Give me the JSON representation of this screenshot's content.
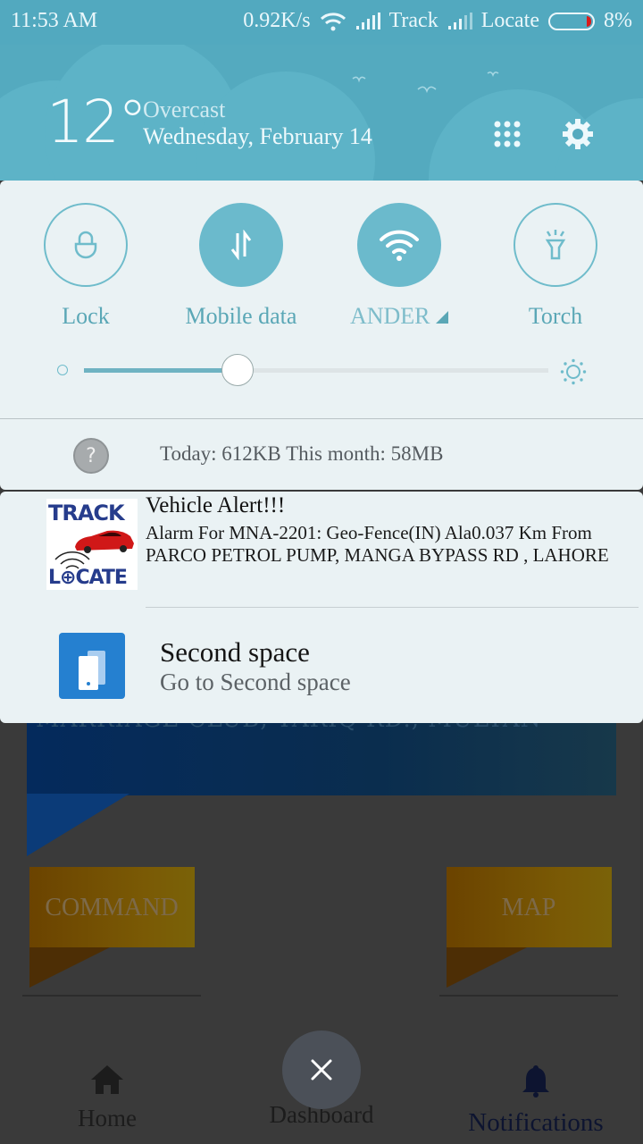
{
  "status_bar": {
    "time": "11:53 AM",
    "net_speed": "0.92K/s",
    "sim1_label": "Track",
    "sim2_label": "Locate",
    "battery": "8%",
    "battery_level_pct": 8
  },
  "weather": {
    "temperature": "12°",
    "condition": "Overcast",
    "date": "Wednesday, February 14"
  },
  "header_icons": [
    "apps-grid-icon",
    "settings-gear-icon"
  ],
  "quick_settings": {
    "tiles": [
      {
        "label": "Lock",
        "icon": "lock-icon",
        "active": false
      },
      {
        "label": "Mobile data",
        "icon": "data-arrows-icon",
        "active": true
      },
      {
        "label": "ANDER",
        "icon": "wifi-icon",
        "active": true
      },
      {
        "label": "Torch",
        "icon": "flashlight-icon",
        "active": false
      }
    ],
    "brightness_pct": 33,
    "data_usage": "Today: 612KB This month: 58MB",
    "help_glyph": "?"
  },
  "notifications": [
    {
      "app": "Track Locate",
      "logo_top": "TRACK",
      "logo_bottom": "L⊕CATE",
      "title": "Vehicle Alert!!!",
      "body": "Alarm For MNA-2201: Geo-Fence(IN) Ala0.037 Km From PARCO PETROL PUMP, MANGA BYPASS RD , LAHORE"
    },
    {
      "app": "Second space",
      "title": "Second space",
      "body": "Go to Second space"
    }
  ],
  "background_app": {
    "banner_text": "MARRIAGE CLUB, TARIQ RD., MULTAN",
    "cards": [
      "COMMAND",
      "MAP"
    ],
    "nav": [
      {
        "label": "Home",
        "icon": "home-icon"
      },
      {
        "label": "Dashboard",
        "icon": "dashboard-icon"
      },
      {
        "label": "Notifications",
        "icon": "bell-icon"
      }
    ],
    "close_glyph": "✕"
  },
  "colors": {
    "accent": "#54aabf",
    "tile_active": "#6bbacc",
    "panel_bg": "#eaf2f4",
    "second_space_blue": "#2580d0",
    "battery_low": "#d81b1b"
  }
}
